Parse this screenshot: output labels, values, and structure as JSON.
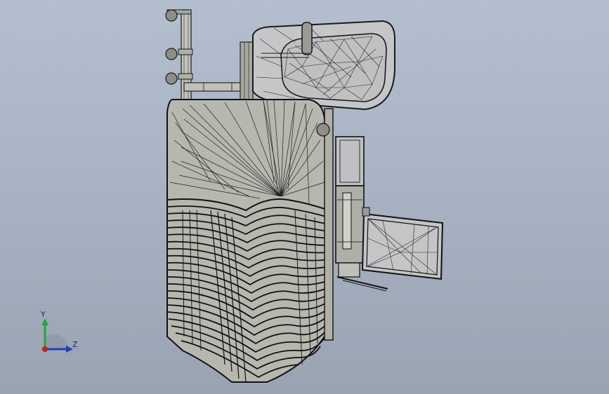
{
  "viewport": {
    "background_top": "#b3bfce",
    "background_bottom": "#9aa3b2"
  },
  "model": {
    "body_fill": "#b9b9b0",
    "mesh_line": "#1a1a1a",
    "mount_fill": "#9aa3b2"
  },
  "triad": {
    "y_label": "Y",
    "z_label": "Z",
    "y_color": "#1fa83a",
    "z_color": "#1c3fbf",
    "x_color": "#d11a1a"
  }
}
